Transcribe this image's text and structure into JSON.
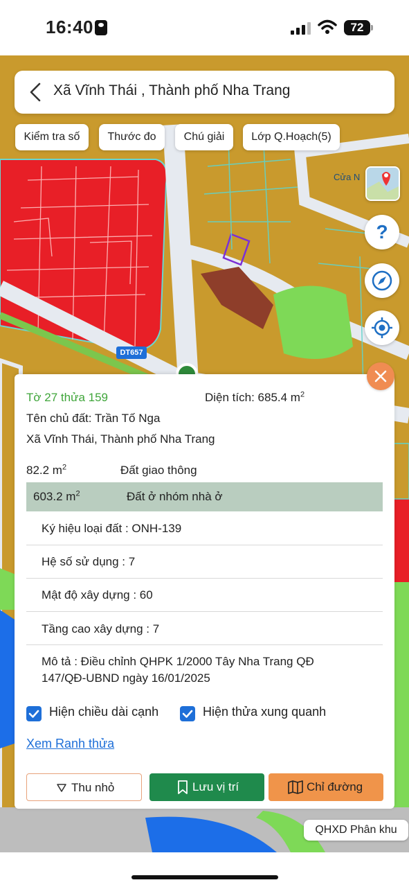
{
  "status_bar": {
    "time": "16:40",
    "battery": "72"
  },
  "header": {
    "title": "Xã Vĩnh Thái , Thành phố Nha Trang"
  },
  "toolbar": {
    "buttons": [
      "Kiểm tra số",
      "Thước đo",
      "Chú giải",
      "Lớp Q.Hoạch(5)"
    ]
  },
  "map_labels": {
    "road": "DT657",
    "poi": "Cửa N"
  },
  "parcel": {
    "sheet_plot": "Tờ 27 thửa 159",
    "area_label": "Diện tích: 685.4 m",
    "area_unit_sup": "2",
    "owner": "Tên chủ đất: Trần Tố Nga",
    "address": "Xã Vĩnh Thái, Thành phố Nha Trang",
    "zones": [
      {
        "area": "82.2 m",
        "sup": "2",
        "type": "Đất giao thông"
      },
      {
        "area": "603.2 m",
        "sup": "2",
        "type": "Đất ở nhóm nhà ở"
      }
    ],
    "details": [
      "Ký hiệu loại đất : ONH-139",
      "Hệ số sử dụng : 7",
      "Mật độ xây dựng : 60",
      "Tầng cao xây dựng : 7"
    ],
    "description_line1": "Mô tả : Điều chỉnh QHPK 1/2000 Tây Nha Trang QĐ",
    "description_line2": "147/QĐ-UBND ngày 16/01/2025"
  },
  "options": {
    "show_edge_length": "Hiện chiều dài cạnh",
    "show_neighbors": "Hiện thửa xung quanh",
    "show_edge_length_checked": true,
    "show_neighbors_checked": true
  },
  "links": {
    "view_boundary": "Xem Ranh thửa"
  },
  "actions": {
    "minimize": "Thu nhỏ",
    "save": "Lưu vị trí",
    "directions": "Chỉ đường"
  },
  "zone_label": "QHXD Phân khu",
  "colors": {
    "green_text": "#3fa53a",
    "save_button": "#1f8a4c",
    "directions_button": "#f0944a",
    "minimize_border": "#e8a27a",
    "link": "#1e6fd8",
    "highlight_row": "#b9cdbf",
    "close_button": "#f08c52"
  }
}
